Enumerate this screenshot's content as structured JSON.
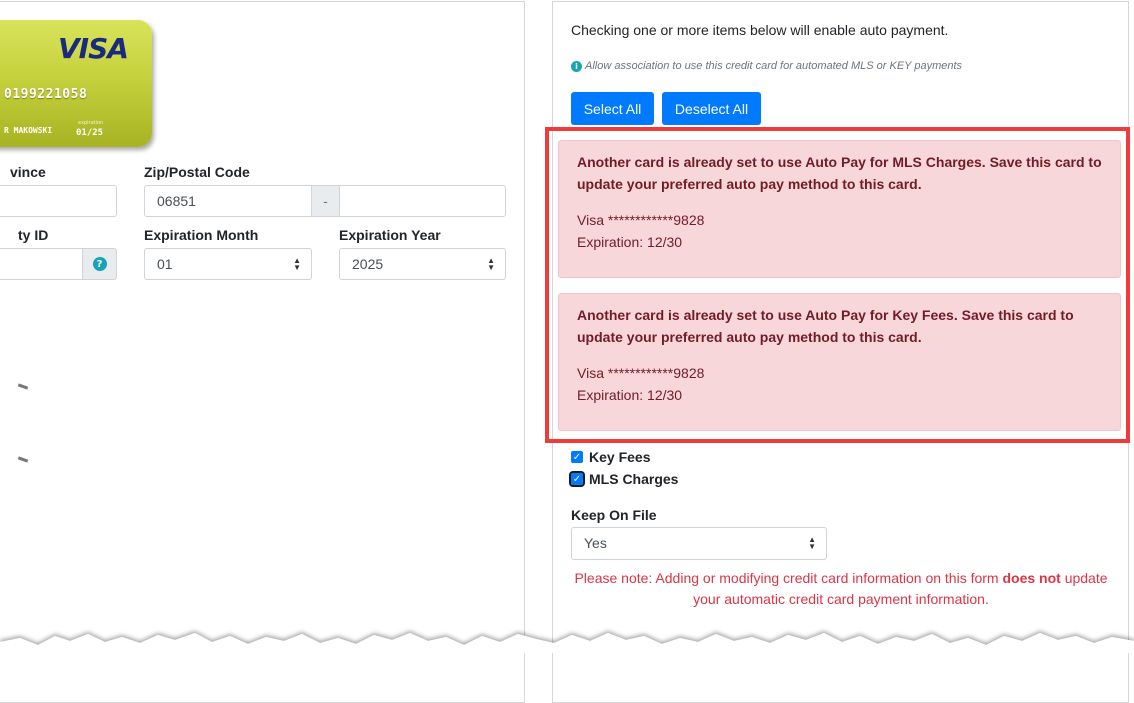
{
  "card": {
    "brand": "VISA",
    "number_fragment": "0199221058",
    "name_fragment": "R MAKOWSKI",
    "exp_label": "expiration",
    "exp": "01/25"
  },
  "left_form": {
    "province_label": "vince",
    "zip_label": "Zip/Postal Code",
    "zip_value": "06851",
    "zip_separator": "-",
    "zip_ext_value": "",
    "security_label": "ty ID",
    "exp_month_label": "Expiration Month",
    "exp_month_value": "01",
    "exp_year_label": "Expiration Year",
    "exp_year_value": "2025",
    "help_symbol": "?"
  },
  "auto_pay": {
    "intro": "Checking one or more items below will enable auto payment.",
    "help_icon": "i",
    "help_text": "Allow association to use this credit card for automated MLS or KEY payments",
    "select_all": "Select All",
    "deselect_all": "Deselect All",
    "alerts": [
      {
        "message": "Another card is already set to use Auto Pay for MLS Charges. Save this card to update your preferred auto pay method to this card.",
        "card": "Visa ************9828",
        "expiration": "Expiration: 12/30"
      },
      {
        "message": "Another card is already set to use Auto Pay for Key Fees. Save this card to update your preferred auto pay method to this card.",
        "card": "Visa ************9828",
        "expiration": "Expiration: 12/30"
      }
    ],
    "options": [
      {
        "label": "Key Fees",
        "checked": true
      },
      {
        "label": "MLS Charges",
        "checked": true
      }
    ],
    "checkmark": "✓",
    "keep_on_file_label": "Keep On File",
    "keep_on_file_value": "Yes",
    "note_prefix": "Please note: Adding or modifying credit card information on this form ",
    "note_bold": "does not",
    "note_suffix": " update your automatic credit card payment information."
  },
  "colors": {
    "primary": "#007bff",
    "alert_bg": "#f8d7da",
    "alert_text": "#721c24",
    "highlight": "#ef3b3b",
    "note": "#dc3545"
  }
}
